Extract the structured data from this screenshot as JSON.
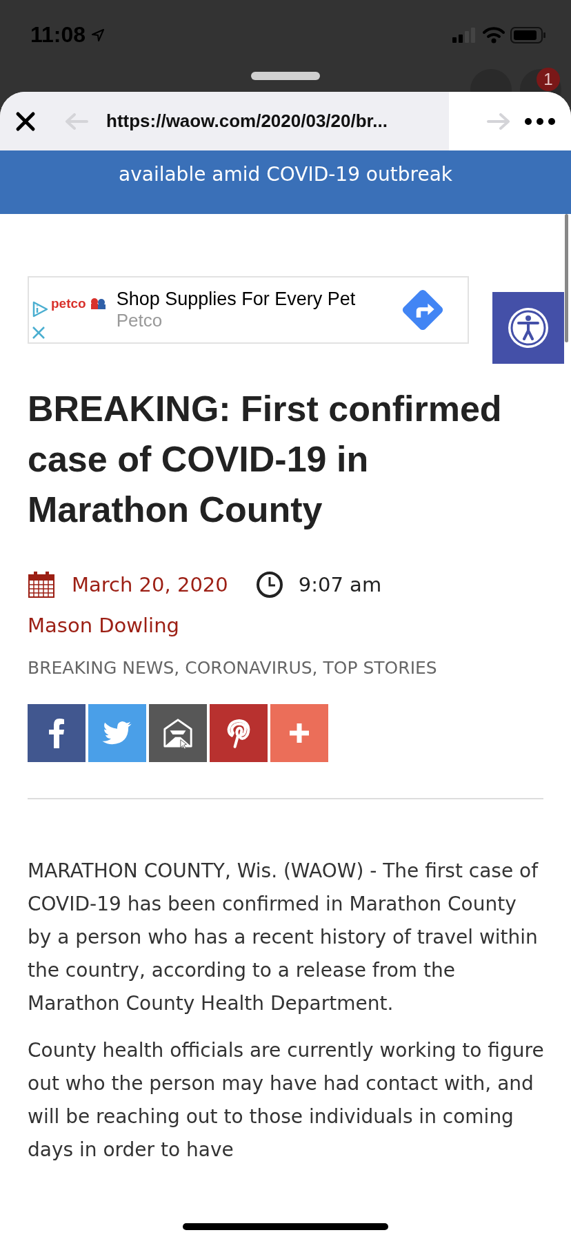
{
  "status_bar": {
    "time": "11:08"
  },
  "background_app": {
    "badge": "1"
  },
  "browser_toolbar": {
    "url": "https://waow.com/2020/03/20/br..."
  },
  "banner": {
    "text": "available amid COVID-19 outbreak"
  },
  "ad": {
    "brand": "petco",
    "title": "Shop Supplies For Every Pet",
    "advertiser": "Petco"
  },
  "article": {
    "headline": "BREAKING: First confirmed case of COVID-19 in Marathon County",
    "date": "March 20, 2020",
    "time": "9:07 am",
    "author": "Mason Dowling",
    "categories": "BREAKING NEWS, CORONAVIRUS, TOP STORIES",
    "share_buttons": [
      {
        "kind": "facebook",
        "color": "#41578f"
      },
      {
        "kind": "twitter",
        "color": "#4a9fe8"
      },
      {
        "kind": "email",
        "color": "#575757"
      },
      {
        "kind": "pinterest",
        "color": "#b8312f"
      },
      {
        "kind": "more",
        "color": "#eb6e59"
      }
    ],
    "paragraphs": [
      "MARATHON COUNTY, Wis. (WAOW) - The first case of COVID-19 has been confirmed in Marathon County by a person who has a recent history of travel within the country, according to a release from the Marathon County Health Department.",
      "County health officials are currently working to figure out who the person may have had contact with, and will be reaching out to those individuals in coming days in order to have"
    ]
  }
}
